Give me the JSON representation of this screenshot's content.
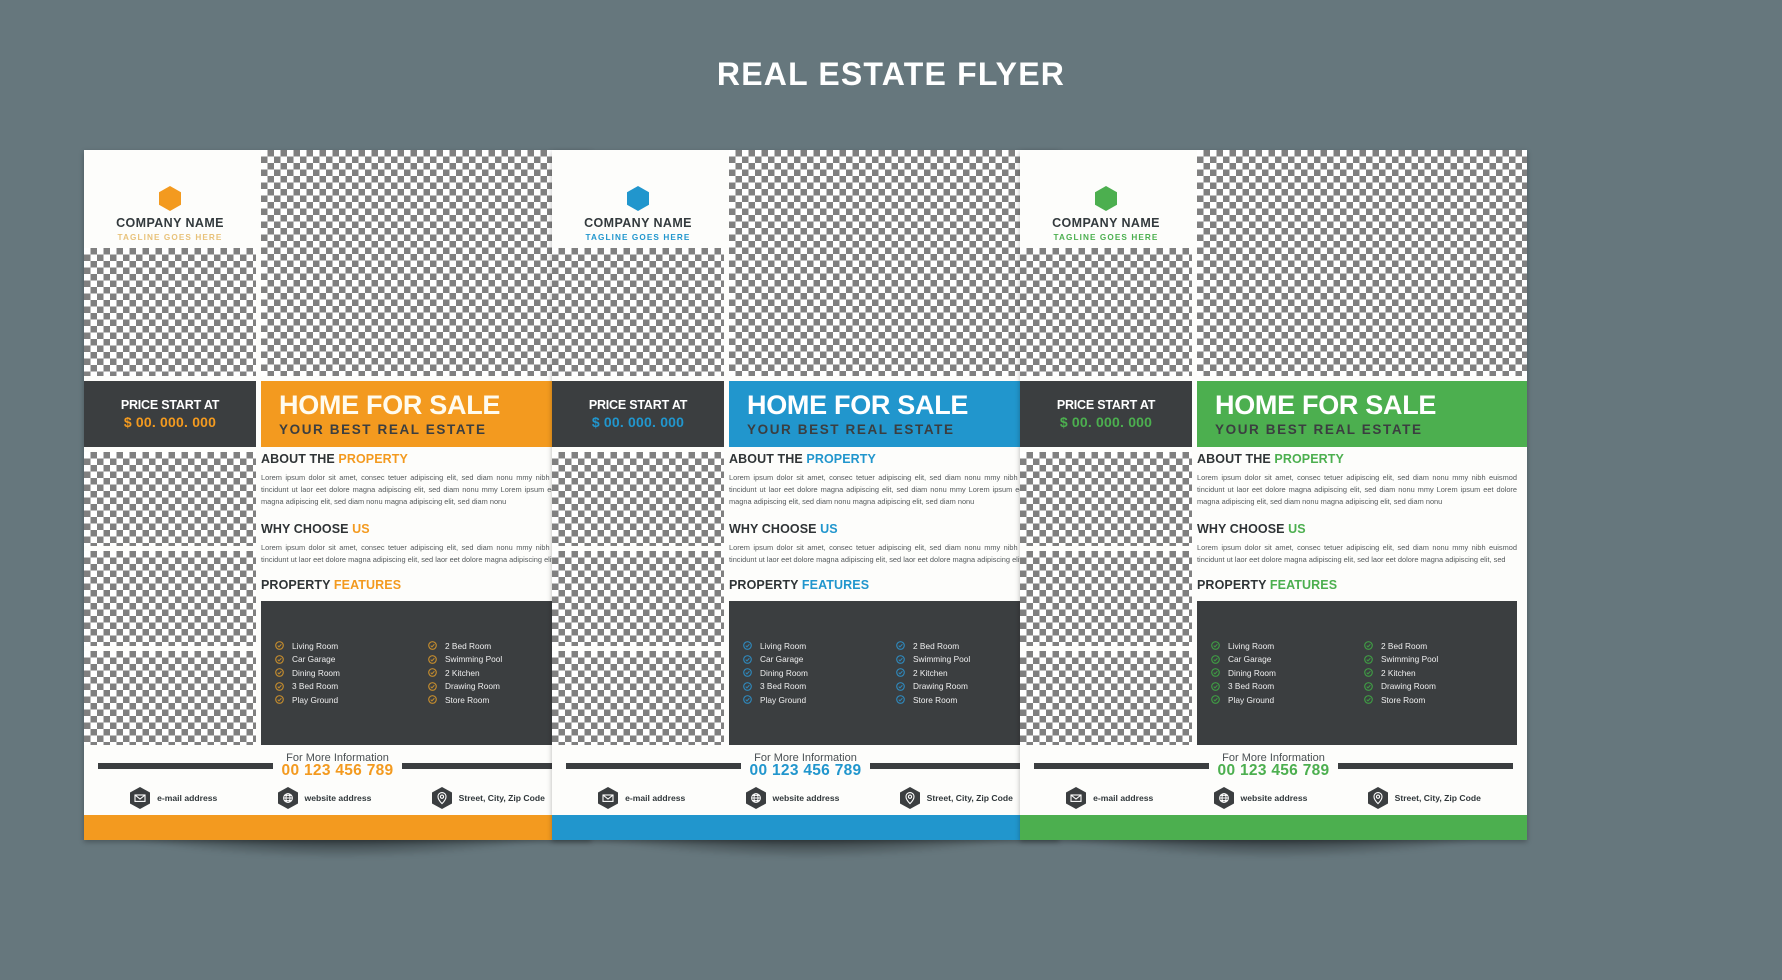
{
  "page": {
    "title": "REAL ESTATE FLYER",
    "background": "#66777d",
    "title_color": "#ffffff"
  },
  "common": {
    "brand": {
      "company_name": "COMPANY NAME",
      "tagline": "TAGLINE GOES HERE",
      "logo_icon": "hexagon-icon"
    },
    "price": {
      "label": "PRICE START AT",
      "value": "$ 00. 000. 000"
    },
    "sale": {
      "title": "HOME FOR SALE",
      "subtitle": "YOUR BEST REAL ESTATE"
    },
    "about": {
      "head_plain": "ABOUT THE ",
      "head_accent": "PROPERTY",
      "body": "Lorem ipsum dolor sit amet, consec tetuer adipiscing elit, sed diam nonu mmy nibh euismod tincidunt ut laor eet dolore magna adipiscing elit, sed diam nonu mmy   Lorem ipsum eet dolore magna adipiscing elit, sed diam nonu magna adipiscing elit, sed diam nonu"
    },
    "why": {
      "head_plain": "WHY CHOOSE ",
      "head_accent": "US",
      "body": "Lorem ipsum dolor sit amet, consec tetuer adipiscing elit, sed diam nonu mmy nibh euismod tincidunt ut laor eet dolore magna adipiscing elit, sed laor eet dolore magna adipiscing elit, sed"
    },
    "features": {
      "head_plain": "PROPERTY ",
      "head_accent": "FEATURES",
      "column_left": [
        "Living Room",
        "Car Garage",
        "Dining Room",
        "3 Bed Room",
        "Play Ground"
      ],
      "column_right": [
        "2 Bed  Room",
        "Swimming Pool",
        "2 Kitchen",
        "Drawing Room",
        "Store Room"
      ],
      "tick_icon": "check-circle-icon"
    },
    "footer": {
      "info_label": "For More Information",
      "phone": "00 123 456 789",
      "contacts": [
        {
          "icon": "envelope-icon",
          "text": "e-mail address"
        },
        {
          "icon": "globe-icon",
          "text": "website address"
        },
        {
          "icon": "location-pin-icon",
          "text": "Street, City, Zip Code"
        }
      ]
    }
  },
  "flyers": [
    {
      "id": "flyer-orange",
      "accent": "#f39a1f",
      "accent_soft": "#e8c27a",
      "tick": "#c08a2e"
    },
    {
      "id": "flyer-blue",
      "accent": "#2196cd",
      "accent_soft": "#2196cd",
      "tick": "#2f86b8"
    },
    {
      "id": "flyer-green",
      "accent": "#4caf4f",
      "accent_soft": "#4caf4f",
      "tick": "#3f9a44"
    }
  ]
}
